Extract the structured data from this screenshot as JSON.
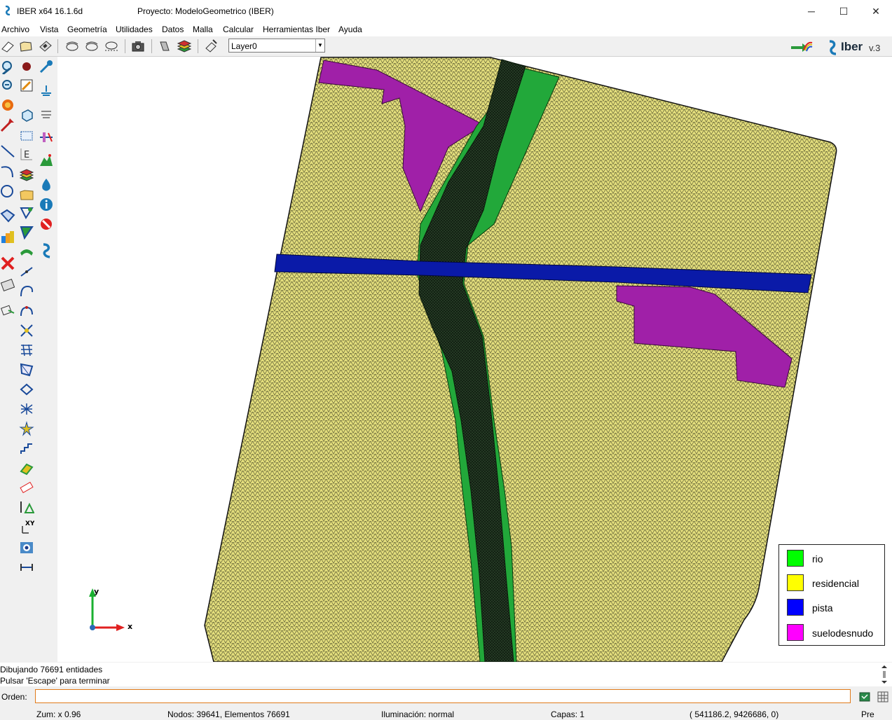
{
  "window": {
    "app_title": "IBER x64 16.1.6d",
    "project_title": "Proyecto: ModeloGeometrico (IBER)",
    "minimize_glyph": "─",
    "maximize_glyph": "☐",
    "close_glyph": "✕"
  },
  "menu": [
    "Archivo",
    "Vista",
    "Geometría",
    "Utilidades",
    "Datos",
    "Malla",
    "Calcular",
    "Herramientas Iber",
    "Ayuda"
  ],
  "toolbar": {
    "layer_value": "Layer0",
    "logo_text": "Iber",
    "logo_version": "v.3"
  },
  "legend": [
    {
      "label": "rio",
      "color": "#00ff00"
    },
    {
      "label": "residencial",
      "color": "#ffff00"
    },
    {
      "label": "pista",
      "color": "#0000ff"
    },
    {
      "label": "suelodesnudo",
      "color": "#ff00ff"
    }
  ],
  "axes": {
    "x": "x",
    "y": "y"
  },
  "messages": {
    "line1": "Dibujando 76691 entidades",
    "line2": "Pulsar 'Escape' para terminar"
  },
  "command": {
    "label": "Orden:",
    "value": ""
  },
  "status": {
    "zoom": "Zum: x 0.96",
    "mesh": "Nodos: 39641, Elementos 76691",
    "lighting": "Iluminación: normal",
    "layers": "Capas: 1",
    "coords": "( 541186.2,  9426686,  0)",
    "mode": "Pre"
  },
  "colors": {
    "residencial": "#e0dc7a",
    "rio": "#22a83a",
    "pista": "#0a1aa8",
    "suelodesnudo": "#a020a8",
    "channel": "#1a2a1a",
    "accent": "#e07a1a"
  }
}
